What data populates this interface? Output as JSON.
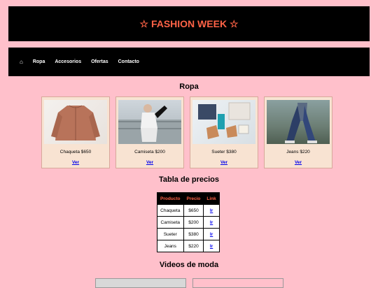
{
  "header": {
    "title": "☆ FASHION WEEK ☆"
  },
  "nav": {
    "home_icon": "⌂",
    "items": [
      "Ropa",
      "Accesorios",
      "Ofertas",
      "Contacto"
    ]
  },
  "ropa": {
    "title": "Ropa",
    "cards": [
      {
        "caption": "Chaqueta $650",
        "link": "Ver"
      },
      {
        "caption": "Camiseta $200",
        "link": "Ver"
      },
      {
        "caption": "Sueter $380",
        "link": "Ver"
      },
      {
        "caption": "Jeans $220",
        "link": "Ver"
      }
    ]
  },
  "precios": {
    "title": "Tabla de precios",
    "headers": [
      "Producto",
      "Precio",
      "Link"
    ],
    "rows": [
      [
        "Chaqueta",
        "$650",
        "Ir"
      ],
      [
        "Camiseta",
        "$200",
        "Ir"
      ],
      [
        "Sueter",
        "$380",
        "Ir"
      ],
      [
        "Jeans",
        "$220",
        "Ir"
      ]
    ]
  },
  "videos": {
    "title": "Videos de moda"
  },
  "colors": {
    "background": "#ffc0cb",
    "accent": "#ff6347",
    "bar": "#000000",
    "card": "#f8e3d2"
  }
}
